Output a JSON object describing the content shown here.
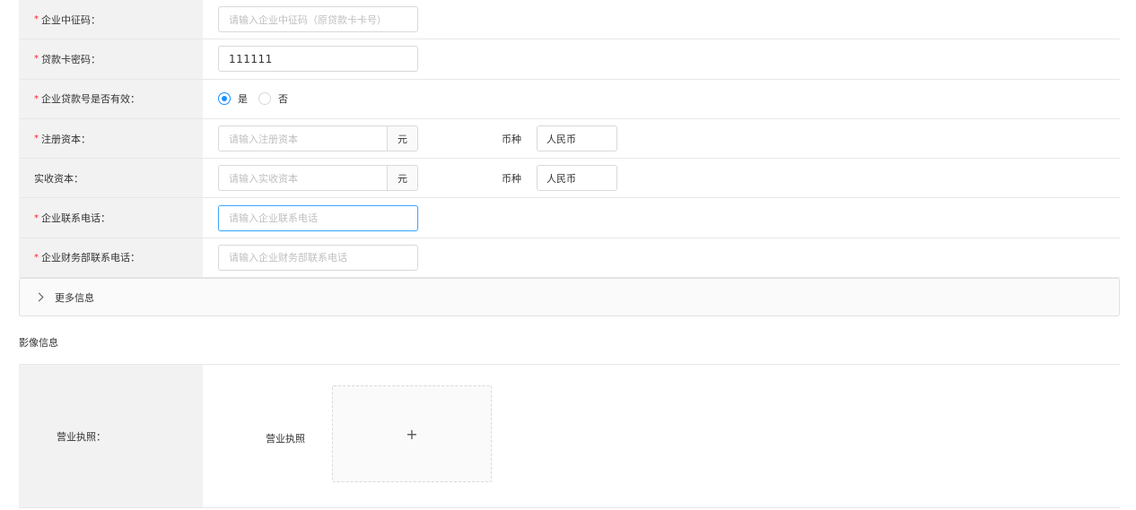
{
  "form": {
    "rows": [
      {
        "label": "企业中征码：",
        "required": true,
        "placeholder": "请输入企业中征码（原贷款卡卡号）",
        "value": ""
      },
      {
        "label": "贷款卡密码：",
        "required": true,
        "placeholder": "",
        "value": "111111"
      },
      {
        "label": "企业贷款号是否有效：",
        "required": true,
        "options": [
          "是",
          "否"
        ],
        "selected": "是"
      },
      {
        "label": "注册资本：",
        "required": true,
        "placeholder": "请输入注册资本",
        "addon": "元",
        "currency_label": "币种",
        "currency_value": "人民币"
      },
      {
        "label": "实收资本：",
        "required": false,
        "placeholder": "请输入实收资本",
        "addon": "元",
        "currency_label": "币种",
        "currency_value": "人民币"
      },
      {
        "label": "企业联系电话：",
        "required": true,
        "placeholder": "请输入企业联系电话"
      },
      {
        "label": "企业财务部联系电话：",
        "required": true,
        "placeholder": "请输入企业财务部联系电话"
      }
    ]
  },
  "required_mark": "*",
  "collapse": {
    "label": "更多信息",
    "icon": "chevron-right-icon"
  },
  "image_section": {
    "title": "影像信息",
    "row_label": "营业执照：",
    "item_label": "营业执照",
    "upload_symbol": "+"
  },
  "colors": {
    "accent": "#1890ff",
    "required": "#f5222d",
    "label_bg": "#f2f2f2"
  }
}
